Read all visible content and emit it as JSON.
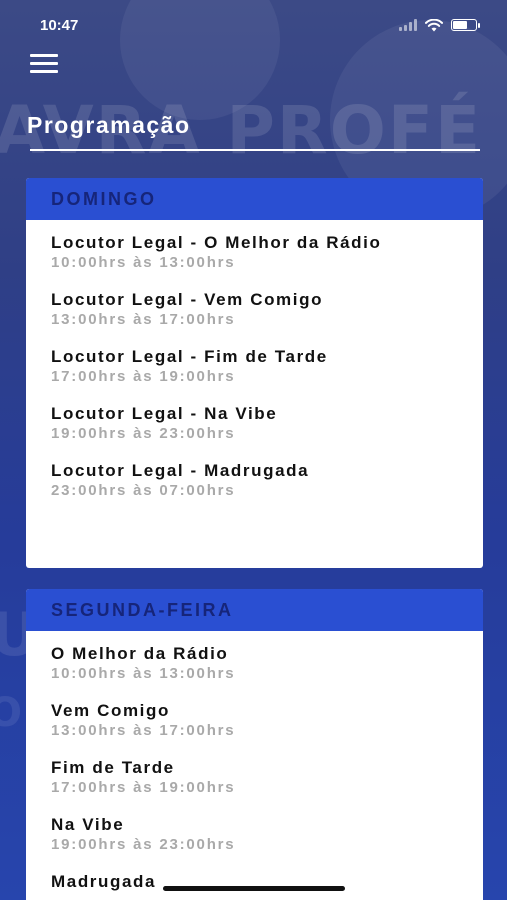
{
  "status_bar": {
    "time": "10:47"
  },
  "background_text": {
    "line1": "AVRA PROFÉ",
    "line2": "U",
    "line3": "O"
  },
  "header": {
    "title": "Programação"
  },
  "schedule": [
    {
      "day": "DOMINGO",
      "shows": [
        {
          "name": "Locutor Legal - O Melhor da Rádio",
          "time": "10:00hrs às 13:00hrs"
        },
        {
          "name": "Locutor Legal - Vem Comigo",
          "time": "13:00hrs às 17:00hrs"
        },
        {
          "name": "Locutor Legal - Fim de Tarde",
          "time": "17:00hrs às 19:00hrs"
        },
        {
          "name": "Locutor Legal - Na Vibe",
          "time": "19:00hrs às 23:00hrs"
        },
        {
          "name": "Locutor Legal - Madrugada",
          "time": "23:00hrs às 07:00hrs"
        }
      ]
    },
    {
      "day": "SEGUNDA-FEIRA",
      "shows": [
        {
          "name": "O Melhor da Rádio",
          "time": "10:00hrs às 13:00hrs"
        },
        {
          "name": "Vem Comigo",
          "time": "13:00hrs às 17:00hrs"
        },
        {
          "name": "Fim de Tarde",
          "time": "17:00hrs às 19:00hrs"
        },
        {
          "name": "Na Vibe",
          "time": "19:00hrs às 23:00hrs"
        },
        {
          "name": "Madrugada",
          "time": ""
        }
      ]
    }
  ],
  "icons": {
    "menu": "hamburger-menu-icon",
    "signal": "cellular-signal-icon",
    "wifi": "wifi-icon",
    "battery": "battery-icon"
  },
  "colors": {
    "accent": "#2a4fd2",
    "day_header_text": "#16257a",
    "time_text": "#a9a9a9"
  }
}
